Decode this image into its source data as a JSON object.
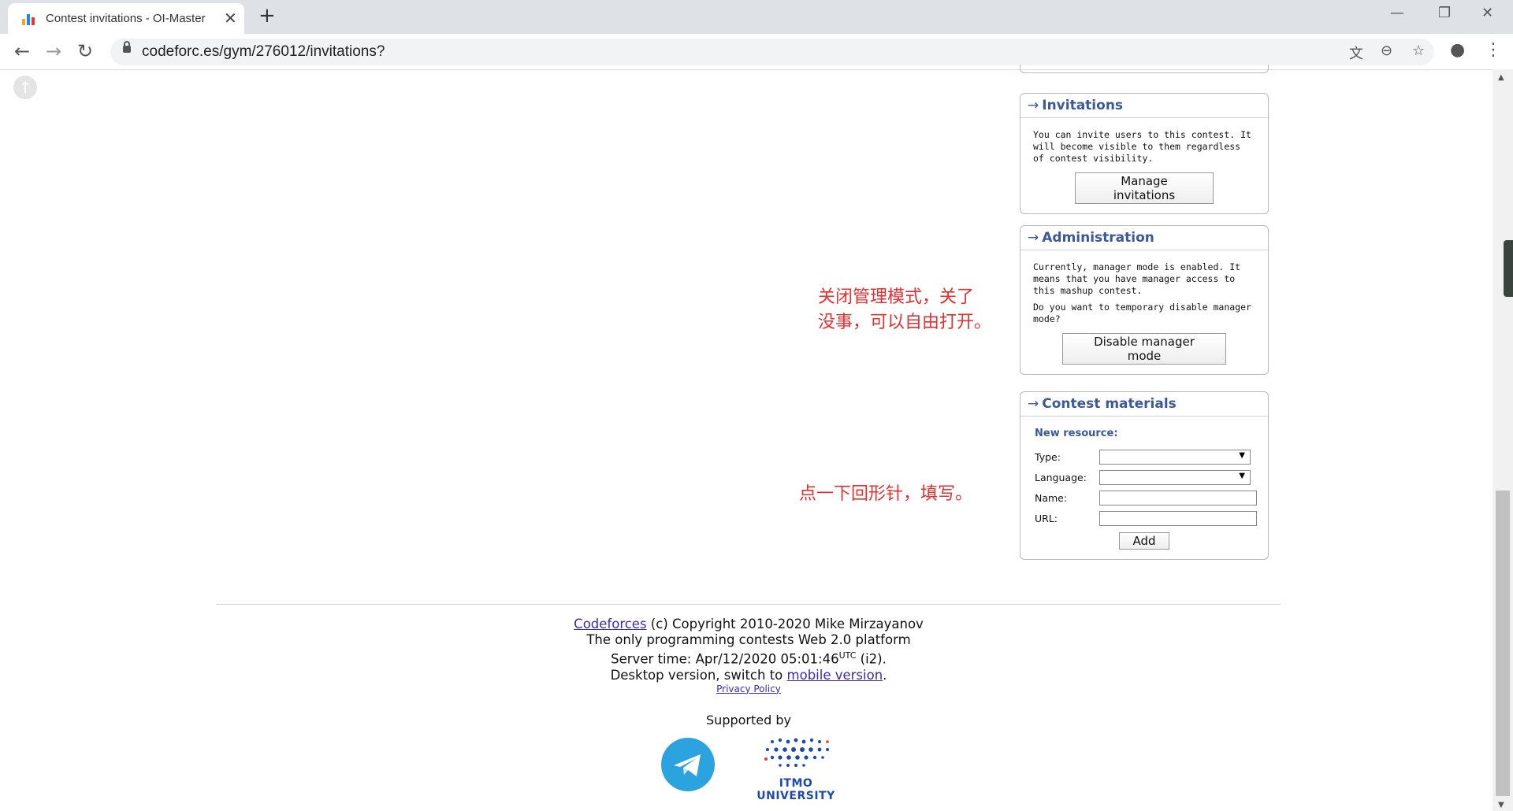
{
  "browser": {
    "tab_title": "Contest invitations - OI-Master",
    "tab_close": "✕",
    "new_tab": "+",
    "url": "codeforc.es/gym/276012/invitations?",
    "window_minimize": "—",
    "window_restore": "❐",
    "window_close": "✕",
    "back": "←",
    "forward": "→",
    "reload": "↻",
    "translate_icon": "文",
    "zoom_icon": "⊖",
    "star_icon": "☆",
    "account_icon": "●",
    "menu_icon": "⋮",
    "favicon_colors": [
      "#f5a623",
      "#1e88e5",
      "#e53935"
    ]
  },
  "page": {
    "scroll_up_icon": "↑",
    "invitations": {
      "arrow": "→",
      "title": "Invitations",
      "text": "You can invite users to this contest. It will become visible to them regardless of contest visibility.",
      "button": "Manage invitations"
    },
    "administration": {
      "arrow": "→",
      "title": "Administration",
      "text1": "Currently, manager mode is enabled. It means that you have manager access to this mashup contest.",
      "text2": "Do you want to temporary disable manager mode?",
      "button": "Disable manager mode"
    },
    "materials": {
      "arrow": "→",
      "title": "Contest materials",
      "new_resource": "New resource:",
      "type_label": "Type:",
      "language_label": "Language:",
      "name_label": "Name:",
      "url_label": "URL:",
      "add_button": "Add"
    },
    "annotations": {
      "manager_line1": "关闭管理模式，关了",
      "manager_line2": "没事，可以自由打开。",
      "materials": "点一下回形针，填写。"
    },
    "footer": {
      "codeforces_link": "Codeforces",
      "copyright": " (c) Copyright 2010-2020 Mike Mirzayanov",
      "tagline": "The only programming contests Web 2.0 platform",
      "server_time_prefix": "Server time: Apr/12/2020 05:01:46",
      "utc": "UTC",
      "server_time_suffix": " (i2).",
      "desktop_prefix": "Desktop version, switch to ",
      "mobile_link": "mobile version",
      "desktop_suffix": ".",
      "privacy": "Privacy Policy",
      "supported_by": "Supported by",
      "itmo": "ITMO UNIVERSITY"
    },
    "colors": {
      "box_title": "#3b5998",
      "annotation": "#e03030",
      "telegram": "#2aa3df",
      "itmo": "#1f4aa8"
    }
  }
}
